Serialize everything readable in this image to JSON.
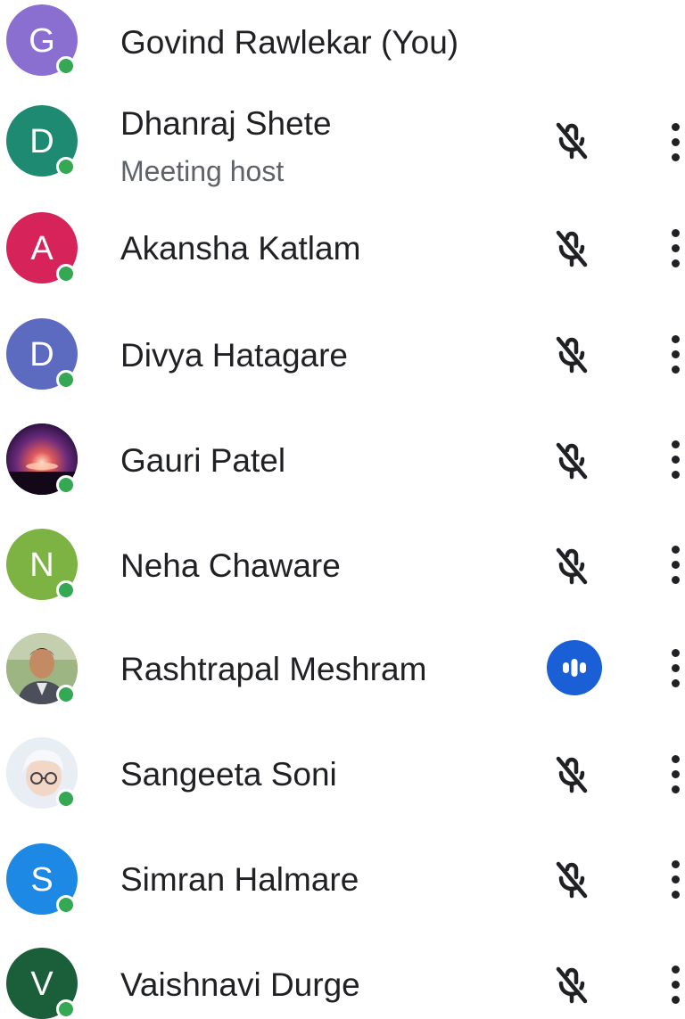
{
  "colors": {
    "presence": "#34a853",
    "speaking": "#1a5fd6",
    "text_primary": "#202124",
    "text_secondary": "#5f6368"
  },
  "participants": [
    {
      "name": "Govind Rawlekar (You)",
      "initial": "G",
      "avatar_color": "#8a6fd1",
      "mic": "none"
    },
    {
      "name": "Dhanraj Shete",
      "subtitle": "Meeting host",
      "initial": "D",
      "avatar_color": "#1e8a72",
      "mic": "muted"
    },
    {
      "name": "Akansha Katlam",
      "initial": "A",
      "avatar_color": "#d6245a",
      "mic": "muted"
    },
    {
      "name": "Divya Hatagare",
      "initial": "D",
      "avatar_color": "#5c6bc0",
      "mic": "muted"
    },
    {
      "name": "Gauri Patel",
      "initial": "",
      "avatar_color": "#3a1e4d",
      "avatar_kind": "photo-nebula",
      "mic": "muted"
    },
    {
      "name": "Neha Chaware",
      "initial": "N",
      "avatar_color": "#7cb342",
      "mic": "muted"
    },
    {
      "name": "Rashtrapal Meshram",
      "initial": "",
      "avatar_color": "#8fae7a",
      "avatar_kind": "photo-man",
      "mic": "speaking"
    },
    {
      "name": "Sangeeta Soni",
      "initial": "",
      "avatar_color": "#dfe6ee",
      "avatar_kind": "photo-child",
      "mic": "muted"
    },
    {
      "name": "Simran Halmare",
      "initial": "S",
      "avatar_color": "#1e88e5",
      "mic": "muted"
    },
    {
      "name": "Vaishnavi Durge",
      "initial": "V",
      "avatar_color": "#1b5e3a",
      "mic": "muted"
    }
  ],
  "icons": {
    "muted": "mic-off-icon",
    "speaking": "speaking-indicator-icon",
    "more": "more-vert-icon"
  }
}
